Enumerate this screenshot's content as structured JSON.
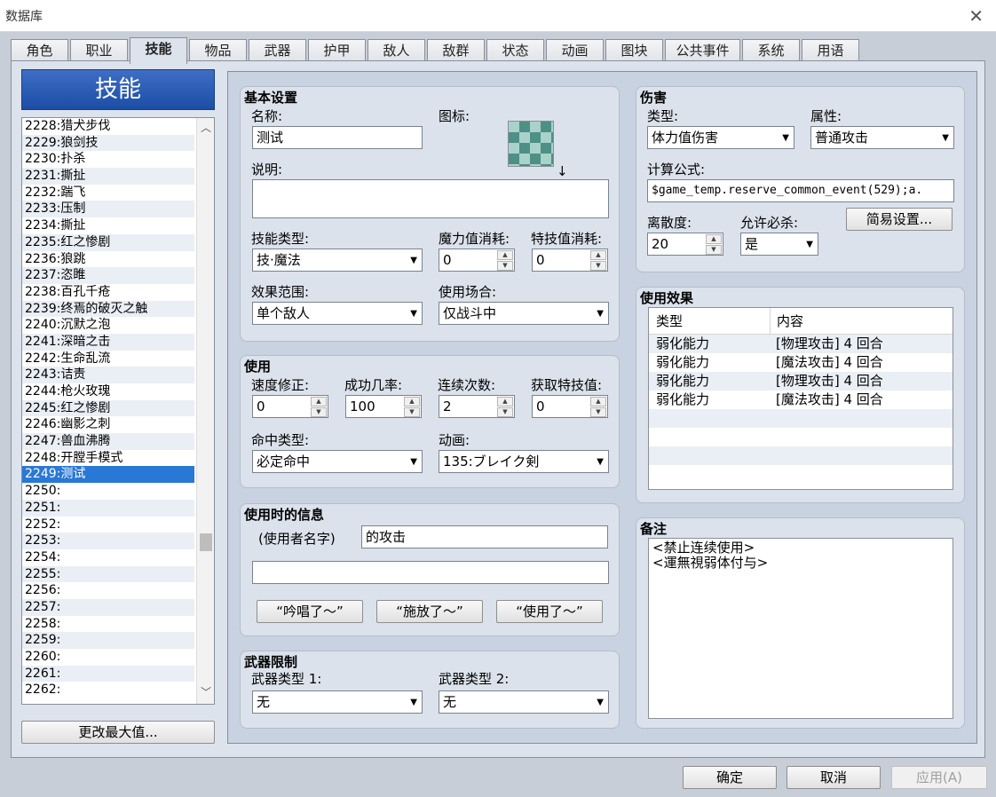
{
  "window": {
    "title": "数据库"
  },
  "tabs": [
    "角色",
    "职业",
    "技能",
    "物品",
    "武器",
    "护甲",
    "敌人",
    "敌群",
    "状态",
    "动画",
    "图块",
    "公共事件",
    "系统",
    "用语"
  ],
  "left_panel": {
    "header": "技能",
    "items": [
      "2228:猎犬步伐",
      "2229:狼剑技",
      "2230:扑杀",
      "2231:撕扯",
      "2232:踹飞",
      "2233:压制",
      "2234:撕扯",
      "2235:红之惨剧",
      "2236:狼跳",
      "2237:恣睢",
      "2238:百孔千疮",
      "2239:终焉的破灭之触",
      "2240:沉默之泡",
      "2241:深暗之击",
      "2242:生命乱流",
      "2243:诘责",
      "2244:枪火玫瑰",
      "2245:红之惨剧",
      "2246:幽影之刺",
      "2247:兽血沸腾",
      "2248:开膛手模式",
      "2249:测试",
      "2250:",
      "2251:",
      "2252:",
      "2253:",
      "2254:",
      "2255:",
      "2256:",
      "2257:",
      "2258:",
      "2259:",
      "2260:",
      "2261:",
      "2262:"
    ],
    "change_max_button": "更改最大值..."
  },
  "basic": {
    "title": "基本设置",
    "name_label": "名称:",
    "name_value": "测试",
    "icon_label": "图标:",
    "desc_label": "说明:",
    "desc_value": "",
    "cursor_mark": "↓",
    "skill_type_label": "技能类型:",
    "skill_type_value": "技·魔法",
    "mp_cost_label": "魔力值消耗:",
    "mp_cost_value": "0",
    "tp_cost_label": "特技值消耗:",
    "tp_cost_value": "0",
    "scope_label": "效果范围:",
    "scope_value": "单个敌人",
    "occasion_label": "使用场合:",
    "occasion_value": "仅战斗中"
  },
  "invocation": {
    "title": "使用",
    "speed_label": "速度修正:",
    "speed_value": "0",
    "success_label": "成功几率:",
    "success_value": "100",
    "repeat_label": "连续次数:",
    "repeat_value": "2",
    "tp_gain_label": "获取特技值:",
    "tp_gain_value": "0",
    "hit_type_label": "命中类型:",
    "hit_type_value": "必定命中",
    "animation_label": "动画:",
    "animation_value": "135:ブレイク剣"
  },
  "message": {
    "title": "使用时的信息",
    "user_name_label": "(使用者名字)",
    "line1": "的攻击",
    "line2": "",
    "btn1": "“吟唱了～”",
    "btn2": "“施放了～”",
    "btn3": "“使用了～”"
  },
  "weapon_req": {
    "title": "武器限制",
    "type1_label": "武器类型 1:",
    "type1_value": "无",
    "type2_label": "武器类型 2:",
    "type2_value": "无"
  },
  "damage": {
    "title": "伤害",
    "type_label": "类型:",
    "type_value": "体力值伤害",
    "element_label": "属性:",
    "element_value": "普通攻击",
    "formula_label": "计算公式:",
    "formula_value": "$game_temp.reserve_common_event(529);a.",
    "variance_label": "离散度:",
    "variance_value": "20",
    "critical_label": "允许必杀:",
    "critical_value": "是",
    "quick_button": "简易设置..."
  },
  "effects": {
    "title": "使用效果",
    "col_type": "类型",
    "col_content": "内容",
    "rows": [
      {
        "type": "弱化能力",
        "content": "[物理攻击] 4 回合"
      },
      {
        "type": "弱化能力",
        "content": "[魔法攻击] 4 回合"
      },
      {
        "type": "弱化能力",
        "content": "[物理攻击] 4 回合"
      },
      {
        "type": "弱化能力",
        "content": "[魔法攻击] 4 回合"
      },
      {
        "type": "",
        "content": ""
      },
      {
        "type": "",
        "content": ""
      },
      {
        "type": "",
        "content": ""
      },
      {
        "type": "",
        "content": ""
      }
    ]
  },
  "notes": {
    "title": "备注",
    "line1": "<禁止连续使用>",
    "line2": "<運無視弱体付与>"
  },
  "footer": {
    "ok": "确定",
    "cancel": "取消",
    "apply": "应用(A)"
  }
}
